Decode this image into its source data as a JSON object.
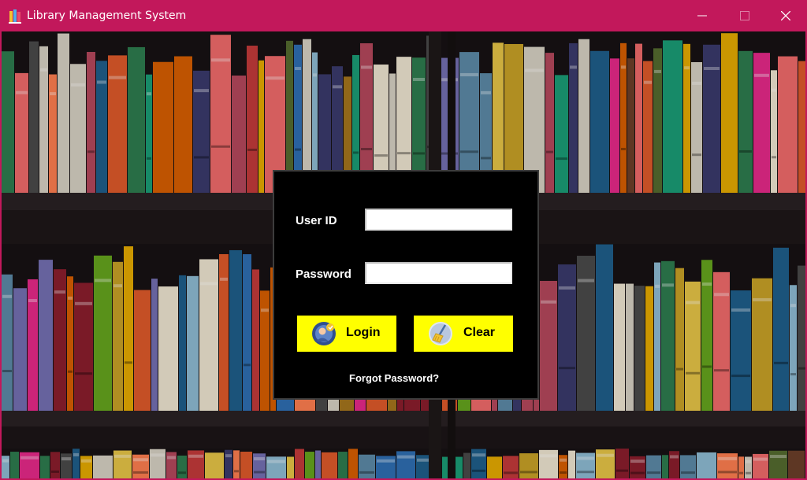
{
  "window": {
    "title": "Library Management System",
    "icon": "books-app-icon",
    "controls": {
      "minimize": "minimize-icon",
      "maximize": "maximize-icon",
      "close": "close-icon"
    }
  },
  "login": {
    "userid_label": "User ID",
    "userid_value": "",
    "password_label": "Password",
    "password_value": "",
    "login_label": "Login",
    "clear_label": "Clear",
    "forgot_label": "Forgot Password?"
  },
  "colors": {
    "titlebar": "#c2185b",
    "panel": "#000000",
    "button": "#ffff00",
    "text": "#ffffff"
  }
}
